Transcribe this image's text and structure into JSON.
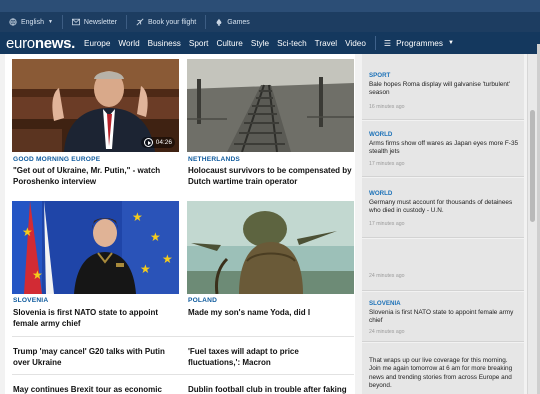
{
  "utility": {
    "language": "English",
    "newsletter": "Newsletter",
    "book_flight": "Book your flight",
    "games": "Games"
  },
  "nav": {
    "logo_a": "euro",
    "logo_b": "news.",
    "links": [
      "Europe",
      "World",
      "Business",
      "Sport",
      "Culture",
      "Style",
      "Sci-tech",
      "Travel",
      "Video"
    ],
    "programmes": "Programmes"
  },
  "articles": [
    {
      "tag": "GOOD MORNING EUROPE",
      "headline": "\"Get out of Ukraine, Mr. Putin,\" - watch Poroshenko interview",
      "duration": "04:26"
    },
    {
      "tag": "NETHERLANDS",
      "headline": "Holocaust survivors to be compensated by Dutch wartime train operator"
    },
    {
      "tag": "SLOVENIA",
      "headline": "Slovenia is first NATO state to appoint female army chief"
    },
    {
      "tag": "POLAND",
      "headline": "Made my son's name Yoda, did I"
    }
  ],
  "text_articles": [
    "Trump 'may cancel' G20 talks with Putin over Ukraine",
    "'Fuel taxes will adapt to price fluctuations,': Macron",
    "May continues Brexit tour as economic",
    "Dublin football club in trouble after faking"
  ],
  "live": [
    {
      "tag": "SPORT",
      "text": "Bale hopes Roma display will galvanise 'turbulent' season",
      "time": "16 minutes ago"
    },
    {
      "tag": "WORLD",
      "text": "Arms firms show off wares as Japan eyes more F-35 stealth jets",
      "time": "17 minutes ago"
    },
    {
      "tag": "WORLD",
      "text": "Germany must account for thousands of detainees who died in custody - U.N.",
      "time": "17 minutes ago"
    },
    {
      "tag": "",
      "text": "",
      "time": "24 minutes ago"
    },
    {
      "tag": "SLOVENIA",
      "text": "Slovenia is first NATO state to appoint female army chief",
      "time": "24 minutes ago"
    },
    {
      "tag": "",
      "text": "That wraps up our live coverage for this morning. Join me again tomorrow at 6 am for more breaking news and trending stories from across Europe and beyond.",
      "time": ""
    }
  ],
  "colors": {
    "nav_bg": "#14385e",
    "util_bg": "#1d3d61",
    "tag_blue": "#0e5a9d",
    "live_tag": "#1d72b8"
  }
}
